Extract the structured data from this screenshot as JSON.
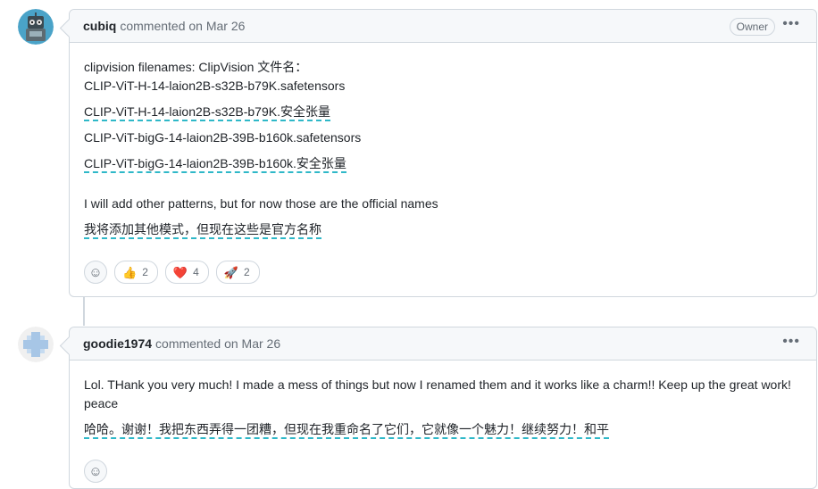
{
  "comments": [
    {
      "author": "cubiq",
      "meta": "commented on Mar 26",
      "badge": "Owner",
      "more_icon": "kebab-horizontal-icon",
      "lines": [
        {
          "text": "clipvision filenames: ClipVision 文件名：",
          "translated": false
        },
        {
          "text": "CLIP-ViT-H-14-laion2B-s32B-b79K.safetensors",
          "translated": false
        },
        {
          "text": "CLIP-ViT-H-14-laion2B-s32B-b79K.安全张量",
          "translated": true
        },
        {
          "text": "CLIP-ViT-bigG-14-laion2B-39B-b160k.safetensors",
          "translated": false
        },
        {
          "text": "CLIP-ViT-bigG-14-laion2B-39B-b160k.安全张量",
          "translated": true
        },
        {
          "text": "I will add other patterns, but for now those are the official names",
          "translated": false
        },
        {
          "text": "我将添加其他模式，但现在这些是官方名称",
          "translated": true
        }
      ],
      "reactions": [
        {
          "emoji": "👍",
          "icon": "thumbs-up-icon",
          "count": "2"
        },
        {
          "emoji": "❤️",
          "icon": "heart-icon",
          "count": "4"
        },
        {
          "emoji": "🚀",
          "icon": "rocket-icon",
          "count": "2"
        }
      ]
    },
    {
      "author": "goodie1974",
      "meta": "commented on Mar 26",
      "more_icon": "kebab-horizontal-icon",
      "lines": [
        {
          "text": "Lol. THank you very much! I made a mess of things but now I renamed them and it works like a charm!! Keep up the great work!",
          "translated": false
        },
        {
          "text": "peace",
          "translated": false
        },
        {
          "text": "哈哈。谢谢！我把东西弄得一团糟，但现在我重命名了它们，它就像一个魅力！继续努力！和平",
          "translated": true
        }
      ]
    }
  ]
}
